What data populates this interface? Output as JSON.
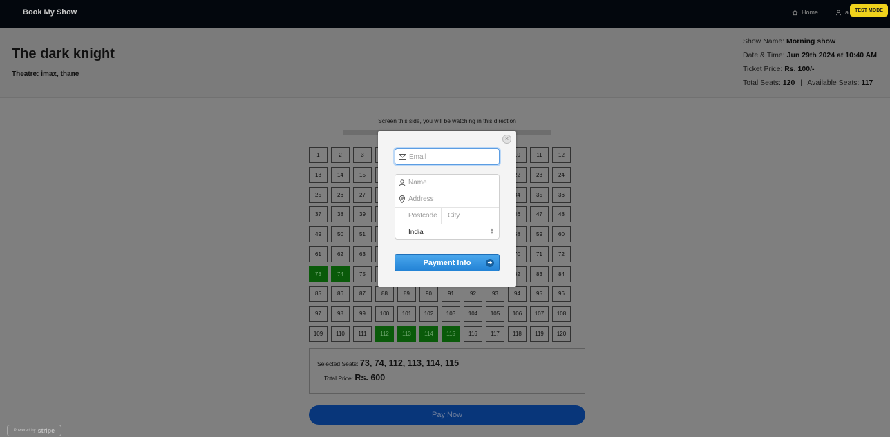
{
  "nav": {
    "brand": "Book My Show",
    "home_label": "Home",
    "user_label": "a",
    "test_mode_label": "TEST MODE"
  },
  "movie": {
    "title": "The dark knight",
    "theatre": "Theatre: imax, thane"
  },
  "show_info": {
    "show_name_label": "Show Name:",
    "show_name": "Morning show",
    "datetime_label": "Date & Time:",
    "datetime": "Jun 29th 2024 at 10:40 AM",
    "price_label": "Ticket Price:",
    "price": "Rs. 100/-",
    "total_seats_label": "Total Seats:",
    "total_seats": "120",
    "separator": "|",
    "available_seats_label": "Available Seats:",
    "available_seats": "117"
  },
  "screen_text": "Screen this side, you will be watching in this direction",
  "seats": {
    "total": 120,
    "per_row": 12,
    "selected": [
      73,
      74,
      112,
      113,
      114,
      115
    ]
  },
  "summary": {
    "selected_label": "Selected Seats:",
    "selected_value": "73, 74, 112, 113, 114, 115",
    "total_label": "Total Price:",
    "total_value": "Rs. 600"
  },
  "pay_now_label": "Pay Now",
  "stripe": {
    "powered_by": "Powered by",
    "brand": "stripe"
  },
  "checkout": {
    "close_glyph": "×",
    "email_placeholder": "Email",
    "name_placeholder": "Name",
    "address_placeholder": "Address",
    "postcode_placeholder": "Postcode",
    "city_placeholder": "City",
    "country_value": "India",
    "submit_label": "Payment Info",
    "submit_arrow": "➔"
  },
  "colors": {
    "nav_bg": "#03070d",
    "overlay_bg": "#7f7f7f",
    "selected_seat": "#0a5a0a",
    "pay_now": "#08367a",
    "checkout_button": "#2383d6",
    "test_badge": "#f0d21c"
  }
}
